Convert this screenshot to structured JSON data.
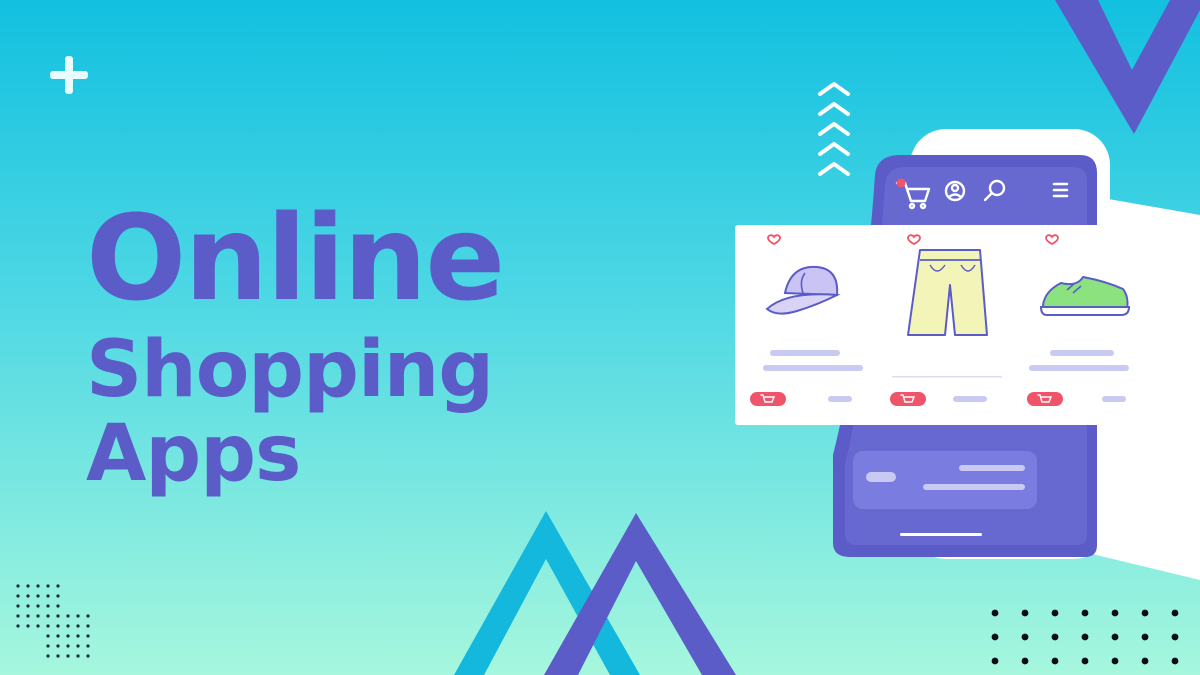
{
  "headline": {
    "line1": "Online",
    "line2": "Shopping",
    "line3": "Apps"
  },
  "colors": {
    "brand_purple": "#5b5cc8",
    "accent_cyan": "#14b8dc",
    "cart_red": "#f0546a",
    "background_top": "#12c0e0",
    "background_bottom": "#a6f7dd"
  },
  "phone": {
    "toolbar_icons": [
      "cart-icon",
      "user-icon",
      "search-icon",
      "menu-icon"
    ],
    "products": [
      {
        "item": "cap-icon",
        "favorite": "heart-icon",
        "cart": "cart-icon"
      },
      {
        "item": "shorts-icon",
        "favorite": "heart-icon",
        "cart": "cart-icon"
      },
      {
        "item": "sneaker-icon",
        "favorite": "heart-icon",
        "cart": "cart-icon"
      }
    ]
  }
}
